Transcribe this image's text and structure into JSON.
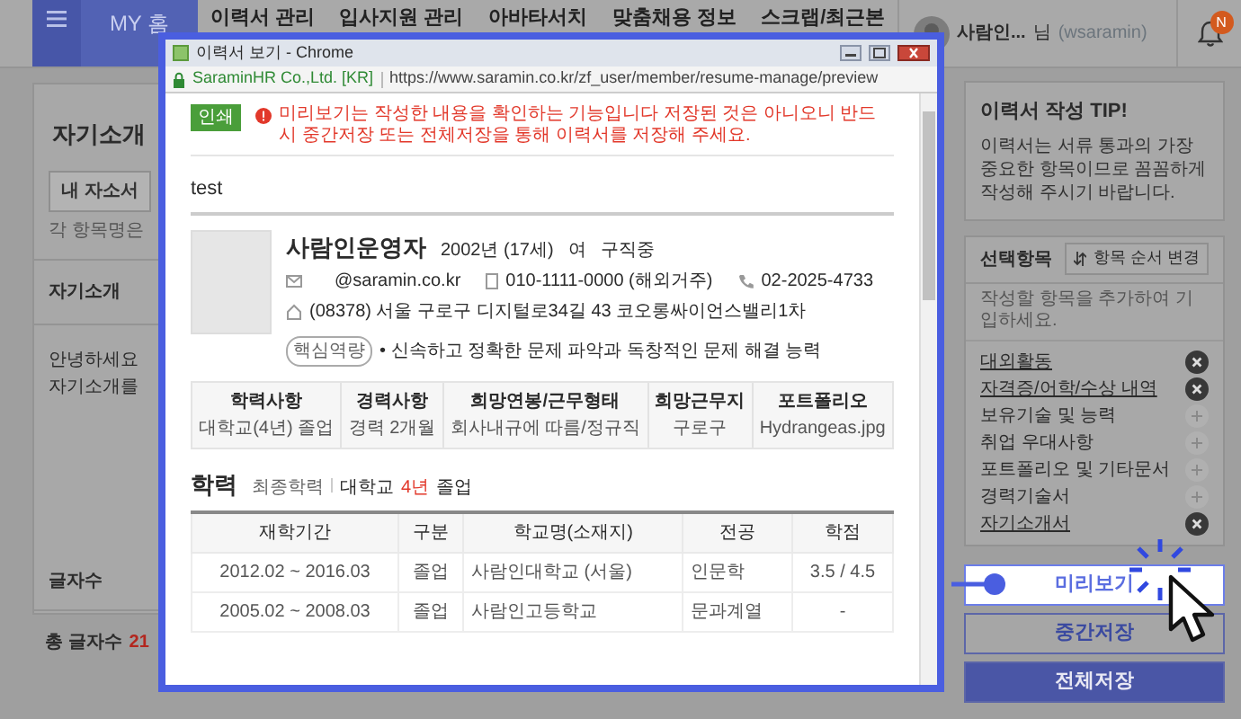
{
  "nav": {
    "home_tab": "MY 홈",
    "items": [
      "이력서 관리",
      "입사지원 관리",
      "아바타서치",
      "맞춤채용 정보",
      "스크랩/최근본"
    ],
    "user_name": "사람인...",
    "user_suffix": "님",
    "user_id": "(wsaramin)",
    "notification_badge": "N"
  },
  "editor": {
    "title": "자기소개",
    "load_button": "내 자소서",
    "hint": "각 항목명은",
    "section_title": "자기소개",
    "body_lines": [
      "안녕하세요",
      "자기소개를"
    ],
    "char_count_label": "글자수",
    "total_label": "총 글자수",
    "total_count": "21"
  },
  "sidebar": {
    "tip_title": "이력서 작성 TIP!",
    "tip_text": "이력서는 서류 통과의 가장 중요한 항목이므로 꼼꼼하게 작성해 주시기 바랍니다.",
    "optional_title": "선택항목",
    "reorder_button": "항목 순서 변경",
    "optional_hint": "작성할 항목을 추가하여 기입하세요.",
    "items": [
      {
        "label": "대외활동",
        "added": true
      },
      {
        "label": "자격증/어학/수상 내역",
        "added": true
      },
      {
        "label": "보유기술 및 능력",
        "added": false
      },
      {
        "label": "취업 우대사항",
        "added": false
      },
      {
        "label": "포트폴리오 및 기타문서",
        "added": false
      },
      {
        "label": "경력기술서",
        "added": false
      },
      {
        "label": "자기소개서",
        "added": true
      }
    ],
    "buttons": [
      {
        "label": "미리보기",
        "kind": "preview",
        "highlighted": true
      },
      {
        "label": "중간저장",
        "kind": "secondary",
        "highlighted": false
      },
      {
        "label": "전체저장",
        "kind": "primary",
        "highlighted": false
      }
    ]
  },
  "popup": {
    "window_title": "이력서 보기 - Chrome",
    "site_identity": "SaraminHR Co.,Ltd. [KR]",
    "url": "https://www.saramin.co.kr/zf_user/member/resume-manage/preview",
    "print_button": "인쇄",
    "notice": "미리보기는 작성한 내용을 확인하는 기능입니다 저장된 것은 아니오니 반드시 중간저장 또는 전체저장을 통해 이력서를 저장해 주세요.",
    "resume_title": "test",
    "profile": {
      "name": "사람인운영자",
      "birth": "2002년 (17세)",
      "gender": "여",
      "status": "구직중",
      "email": "@saramin.co.kr",
      "mobile": "010-1111-0000 (해외거주)",
      "phone": "02-2025-4733",
      "address": "(08378) 서울 구로구 디지털로34길 43 코오롱싸이언스밸리1차",
      "competency_tag": "핵심역량",
      "competency": "• 신속하고 정확한 문제 파악과 독창적인 문제 해결 능력"
    },
    "summary": [
      {
        "label": "학력사항",
        "value": "대학교(4년) 졸업"
      },
      {
        "label": "경력사항",
        "value": "경력 2개월"
      },
      {
        "label": "희망연봉/근무형태",
        "value": "회사내규에 따름/정규직"
      },
      {
        "label": "희망근무지",
        "value": "구로구"
      },
      {
        "label": "포트폴리오",
        "value": "Hydrangeas.jpg"
      }
    ],
    "education": {
      "title": "학력",
      "final_label": "최종학력",
      "final_prefix": "대학교",
      "final_years": "4년",
      "final_suffix": "졸업",
      "columns": [
        "재학기간",
        "구분",
        "학교명(소재지)",
        "전공",
        "학점"
      ],
      "rows": [
        [
          "2012.02 ~ 2016.03",
          "졸업",
          "사람인대학교 (서울)",
          "인문학",
          "3.5 / 4.5"
        ],
        [
          "2005.02 ~ 2008.03",
          "졸업",
          "사람인고등학교",
          "문과계열",
          "-"
        ]
      ]
    }
  }
}
